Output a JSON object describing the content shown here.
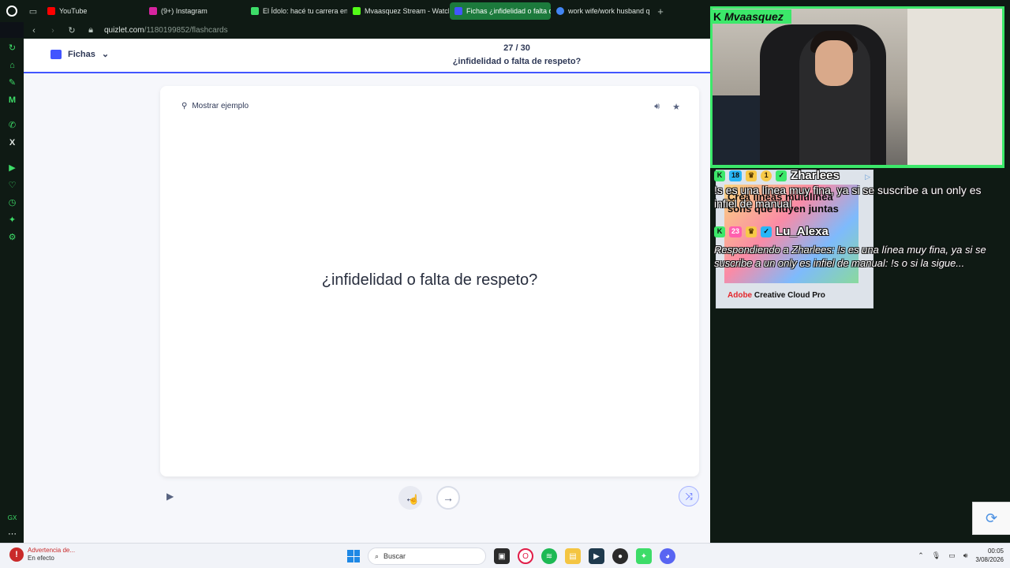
{
  "browser": {
    "tabs": [
      {
        "label": "YouTube",
        "color": "#ff0000",
        "active": false
      },
      {
        "label": "(9+) Instagram",
        "color": "#d6249f",
        "active": false
      },
      {
        "label": "El Ídolo: hacé tu carrera en",
        "color": "#3ddc68",
        "active": false
      },
      {
        "label": "Mvaasquez Stream - Watch",
        "color": "#53fc18",
        "active": false
      },
      {
        "label": "Fichas ¿infidelidad o falta d",
        "color": "#4255ff",
        "active": true
      },
      {
        "label": "work wife/work husband q",
        "color": "#4285f4",
        "active": false
      }
    ],
    "new_tab": "+",
    "url_host": "quizlet.com",
    "url_path": "/1180199852/flashcards"
  },
  "page": {
    "mode_label": "Fichas",
    "progress": "27 / 30",
    "set_title": "¿infidelidad o falta de respeto?",
    "hint_label": "Mostrar ejemplo",
    "card_term": "¿infidelidad o falta de respeto?",
    "current_card": 27,
    "total_cards": 30
  },
  "stream": {
    "streamer": "Mvaasquez",
    "ad_text": "Crea líneas multilínea sons que fluyen juntas",
    "ad_brand_red": "Adobe",
    "ad_brand_rest": " Creative Cloud Pro",
    "chat": [
      {
        "badges": [
          "18",
          "1"
        ],
        "user": "Zharlees",
        "message": "!s es una línea muy fina, ya si se suscribe a un only es infiel de manual"
      },
      {
        "badges": [
          "23"
        ],
        "user": "Lu_Alexa",
        "message": "Respondiendo a Zharlees: !s es una línea muy fina, ya si se suscribe a un only es infiel de manual: !s o si la sigue..."
      }
    ]
  },
  "taskbar": {
    "warning_title": "Advertencia de...",
    "warning_sub": "En efecto",
    "search_placeholder": "Buscar",
    "time": "00:05",
    "date": "3/08/2026"
  },
  "colors": {
    "accent": "#4255ff",
    "stream_green": "#3ce86a",
    "browser_dark": "#0f1a14"
  }
}
